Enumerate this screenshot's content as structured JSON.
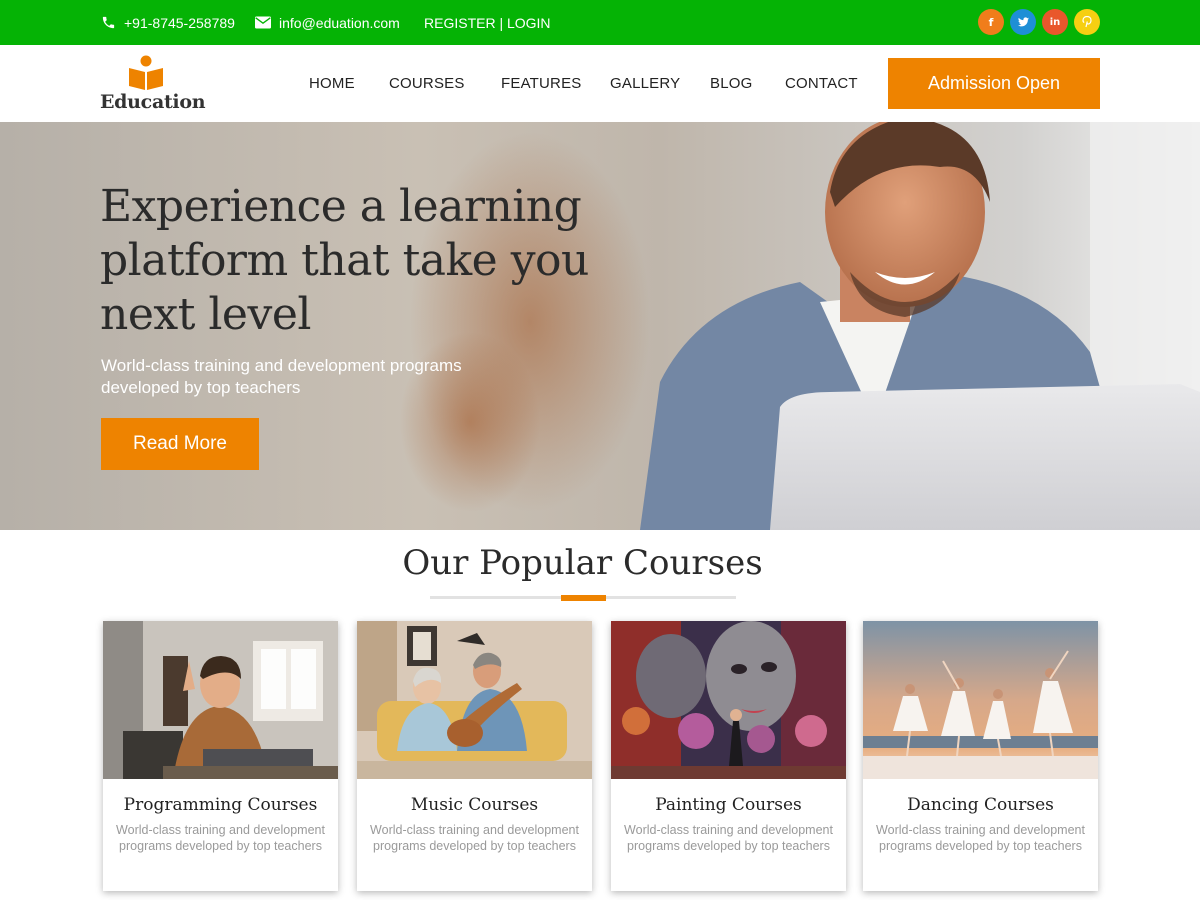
{
  "topbar": {
    "phone": "+91-8745-258789",
    "email": "info@eduation.com",
    "auth": "REGISTER | LOGIN",
    "social": [
      {
        "name": "facebook-icon",
        "glyph": "f",
        "color": "#f07d1b"
      },
      {
        "name": "twitter-icon",
        "glyph": "t",
        "color": "#1e8fd6"
      },
      {
        "name": "linkedin-icon",
        "glyph": "in",
        "color": "#e9572c"
      },
      {
        "name": "pinterest-icon",
        "glyph": "p",
        "color": "#f6cf12"
      }
    ]
  },
  "header": {
    "logo_text": "Education",
    "nav": [
      "HOME",
      "COURSES",
      "FEATURES",
      "GALLERY",
      "BLOG",
      "CONTACT"
    ],
    "cta": "Admission Open"
  },
  "hero": {
    "title": "Experience a learning platform that take you next level",
    "subtitle": "World-class training and development programs developed by top teachers",
    "button": "Read More"
  },
  "courses": {
    "title": "Our Popular Courses",
    "items": [
      {
        "title": "Programming Courses",
        "desc": "World-class training and development programs developed by top teachers"
      },
      {
        "title": "Music Courses",
        "desc": "World-class training and development programs developed by top teachers"
      },
      {
        "title": "Painting Courses",
        "desc": "World-class training and development programs developed by top teachers"
      },
      {
        "title": "Dancing Courses",
        "desc": "World-class training and development programs developed by top teachers"
      }
    ]
  },
  "colors": {
    "topbar": "#05b305",
    "accent": "#ee8300"
  }
}
